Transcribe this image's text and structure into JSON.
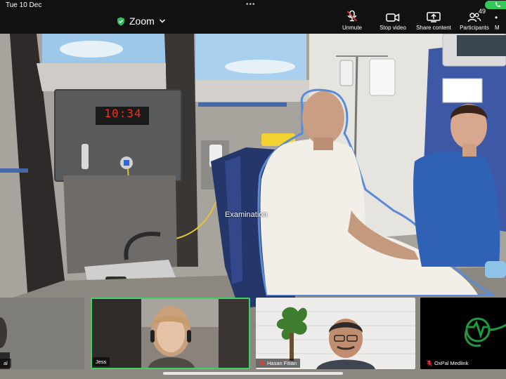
{
  "status_bar": {
    "time": "Tue 10 Dec",
    "dots": "•••"
  },
  "header": {
    "app_title": "Zoom"
  },
  "toolbar": {
    "unmute": "Unmute",
    "stop_video": "Stop video",
    "share_content": "Share content",
    "participants": "Participants",
    "participant_count": "49",
    "more": "M"
  },
  "scene": {
    "clock": "10:34",
    "label": "Examination"
  },
  "tiles": [
    {
      "name": "al"
    },
    {
      "name": "Jess"
    },
    {
      "name": "Hasan Fitian"
    },
    {
      "name": "OxPal Medlink"
    }
  ],
  "colors": {
    "active_speaker": "#3ed163",
    "muted_icon": "#e53935",
    "clock_led": "#ff2a1e",
    "call_pill": "#34c759"
  }
}
